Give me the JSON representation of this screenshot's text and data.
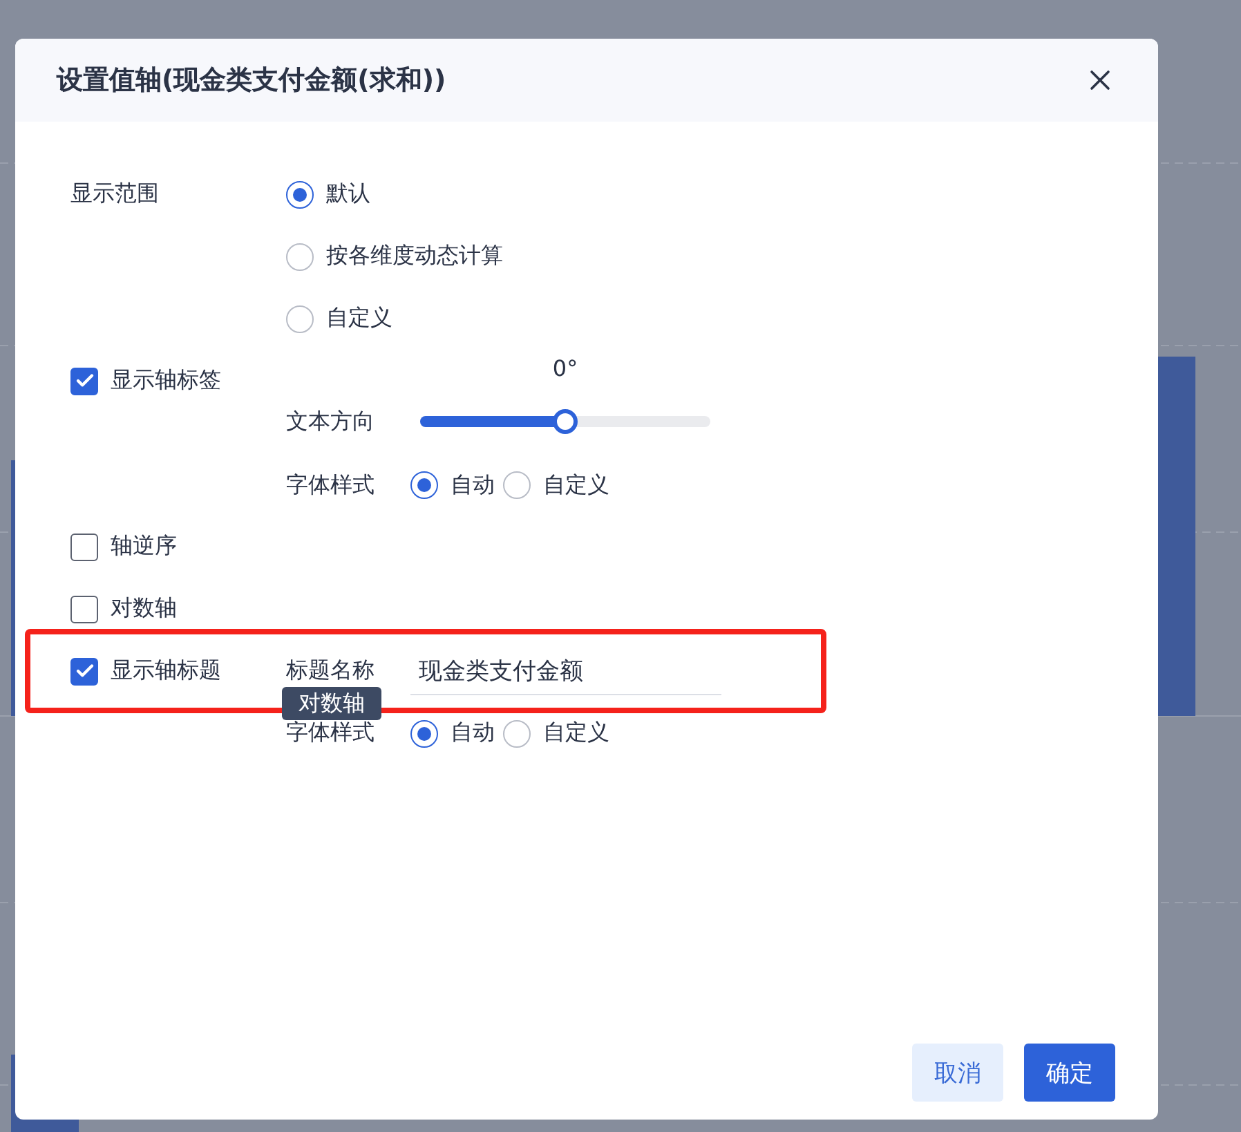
{
  "dialog": {
    "title": "设置值轴(现金类支付金额(求和))"
  },
  "display_range": {
    "label": "显示范围",
    "options": [
      {
        "label": "默认",
        "selected": true
      },
      {
        "label": "按各维度动态计算",
        "selected": false
      },
      {
        "label": "自定义",
        "selected": false
      }
    ]
  },
  "show_axis_label": {
    "label": "显示轴标签",
    "checked": true,
    "text_direction": {
      "label": "文本方向",
      "level": 0.5,
      "reading": "0°"
    },
    "font_style": {
      "label": "字体样式",
      "options": [
        {
          "label": "自动",
          "selected": true
        },
        {
          "label": "自定义",
          "selected": false
        }
      ]
    }
  },
  "reverse_axis": {
    "label": "轴逆序",
    "checked": false
  },
  "log_axis": {
    "label": "对数轴",
    "checked": false
  },
  "show_axis_title": {
    "label": "显示轴标题",
    "checked": true,
    "title_name": {
      "label": "标题名称",
      "value": "现金类支付金额"
    },
    "font_style": {
      "label": "字体样式",
      "options": [
        {
          "label": "自动",
          "selected": true
        },
        {
          "label": "自定义",
          "selected": false
        }
      ]
    }
  },
  "tooltip": {
    "text": "对数轴"
  },
  "buttons": [
    {
      "label": "取消",
      "kind": "secondary"
    },
    {
      "label": "确定",
      "kind": "primary"
    }
  ]
}
